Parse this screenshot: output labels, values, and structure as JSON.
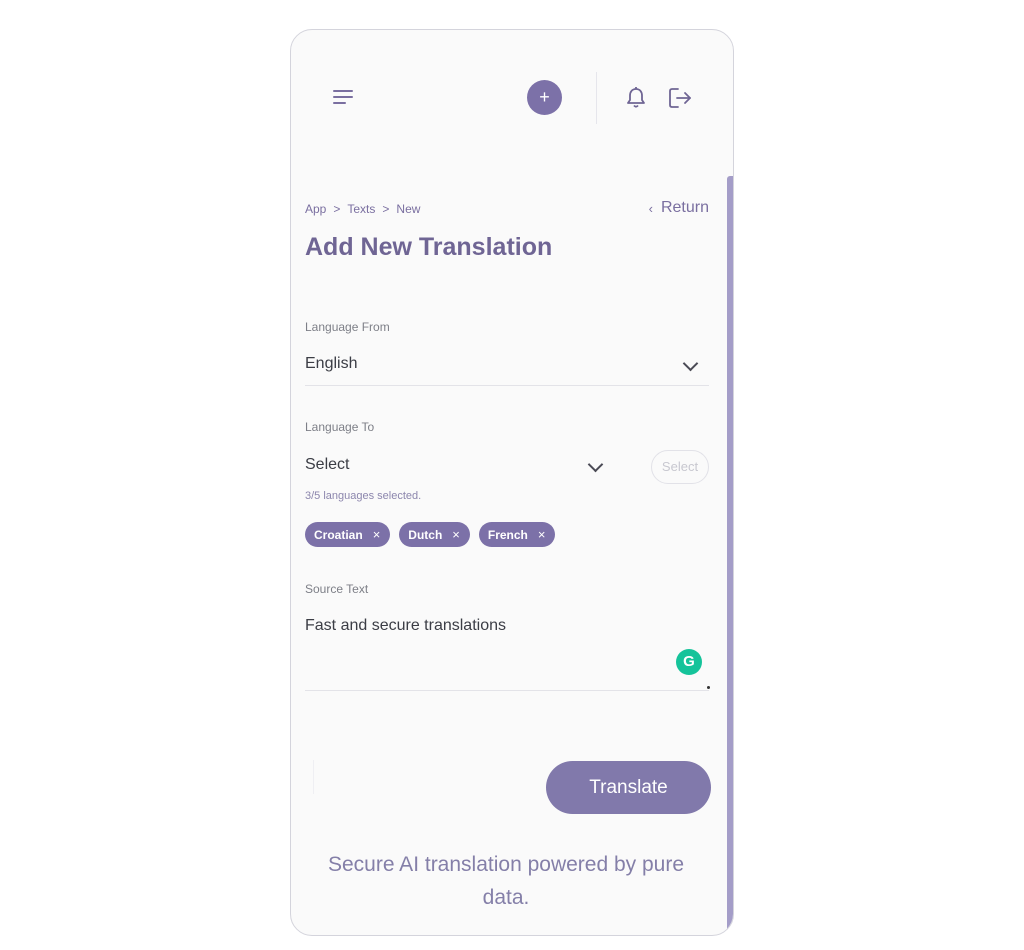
{
  "header": {
    "menu_icon": "hamburger-icon",
    "add_icon": "plus-icon",
    "add_label": "+",
    "bell_icon": "bell-icon",
    "logout_icon": "logout-icon"
  },
  "breadcrumb": [
    "App",
    "Texts",
    "New"
  ],
  "breadcrumb_separator": ">",
  "return_label": "Return",
  "page_title": "Add New Translation",
  "form": {
    "language_from": {
      "label": "Language From",
      "value": "English"
    },
    "language_to": {
      "label": "Language To",
      "value": "Select",
      "button_label": "Select",
      "hint": "3/5 languages selected.",
      "selected": [
        "Croatian",
        "Dutch",
        "French"
      ],
      "remove_glyph": "×"
    },
    "source_text": {
      "label": "Source Text",
      "value": "Fast and secure translations"
    }
  },
  "grammarly_glyph": "G",
  "translate_label": "Translate",
  "tagline": "Secure AI translation powered by pure data.",
  "colors": {
    "accent": "#7c71a8",
    "title": "#6f6594",
    "grammarly": "#15c39a"
  }
}
